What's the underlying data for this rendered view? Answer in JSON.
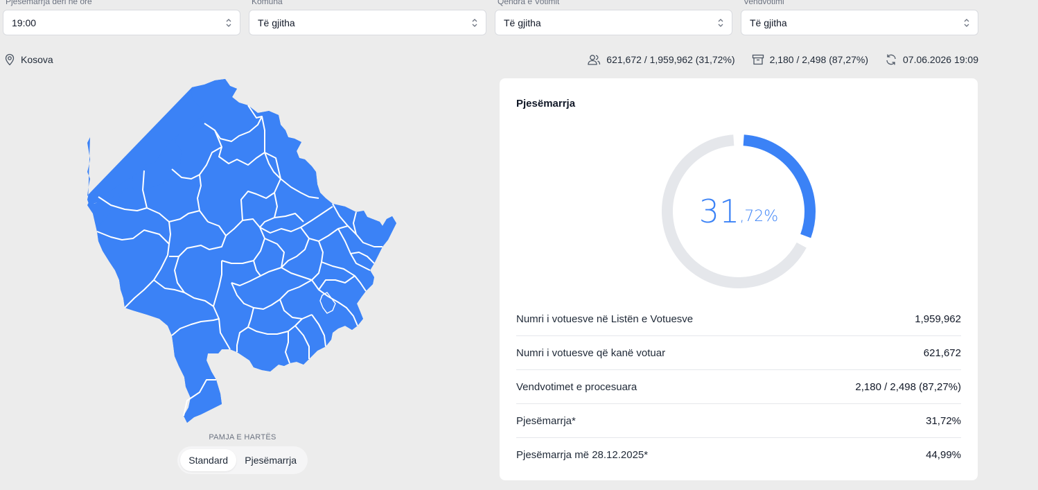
{
  "filters": [
    {
      "label": "Pjesëmarrja deri në orë",
      "value": "19:00"
    },
    {
      "label": "Komuna",
      "value": "Të gjitha"
    },
    {
      "label": "Qendra e Votimit",
      "value": "Të gjitha"
    },
    {
      "label": "Vendvotimi",
      "value": "Të gjitha"
    }
  ],
  "location": {
    "icon": "map-pin-icon",
    "name": "Kosova"
  },
  "stats": {
    "voters": "621,672 / 1,959,962 (31,72%)",
    "stations": "2,180 / 2,498 (87,27%)",
    "updated": "07.06.2026 19:09"
  },
  "map": {
    "fill_color": "#3b82f6",
    "view_label": "PAMJA E HARTËS",
    "toggle": [
      "Standard",
      "Pjesëmarrja"
    ],
    "active": "Standard"
  },
  "card": {
    "title": "Pjesëmarrja",
    "donut": {
      "percent": 31.72,
      "integer": "31",
      "decimal": ",72%",
      "color": "#3b82f6",
      "track_color": "#e5e7eb"
    },
    "rows": [
      {
        "label": "Numri i votuesve në Listën e Votuesve",
        "value": "1,959,962"
      },
      {
        "label": "Numri i votuesve që kanë votuar",
        "value": "621,672"
      },
      {
        "label": "Vendvotimet e procesuara",
        "value": "2,180 / 2,498 (87,27%)"
      },
      {
        "label": "Pjesëmarrja*",
        "value": "31,72%"
      },
      {
        "label": "Pjesëmarrja më 28.12.2025*",
        "value": "44,99%"
      }
    ]
  }
}
